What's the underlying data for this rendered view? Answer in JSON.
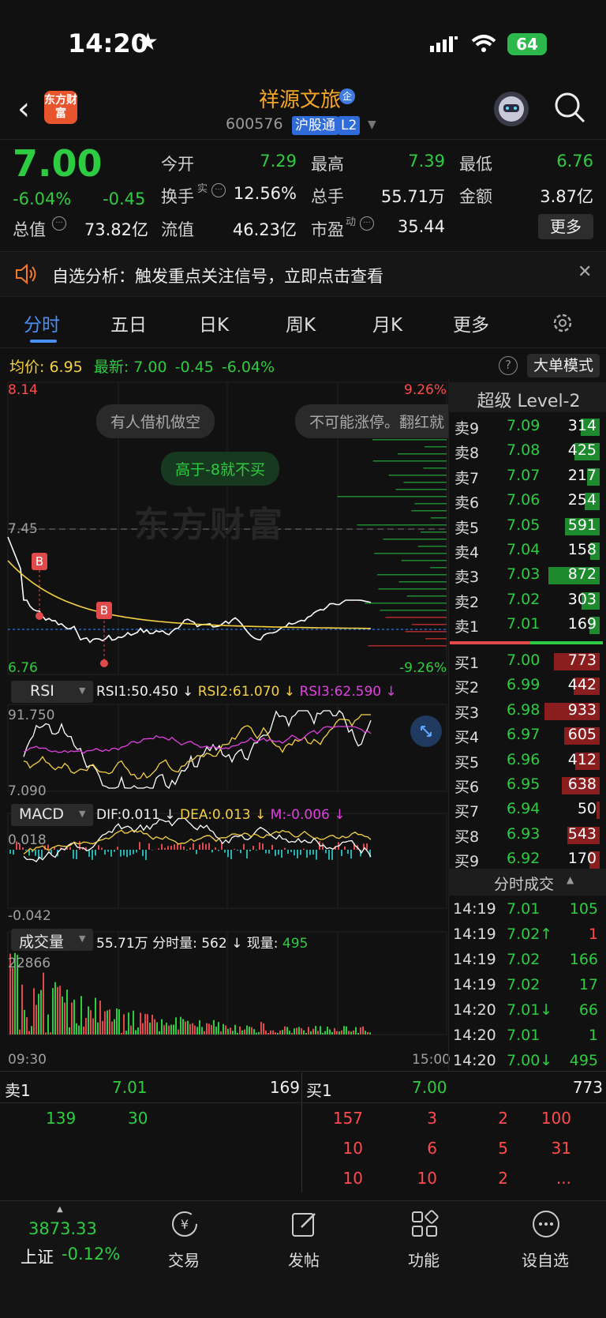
{
  "status_bar": {
    "time": "14:20",
    "battery": "64"
  },
  "header": {
    "logo_text": "东方财富",
    "stock_name": "祥源文旅",
    "stock_code": "600576",
    "tags": [
      "沪股通",
      "L2"
    ]
  },
  "quote": {
    "price": "7.00",
    "change_pct": "-6.04%",
    "change": "-0.45",
    "open_label": "今开",
    "open": "7.29",
    "high_label": "最高",
    "high": "7.39",
    "low_label": "最低",
    "low": "6.76",
    "turnover_label": "换手",
    "turnover_sup": "实",
    "turnover": "12.56%",
    "volume_label": "总手",
    "volume": "55.71万",
    "amount_label": "金额",
    "amount": "3.87亿",
    "mktcap_label": "总值",
    "mktcap": "73.82亿",
    "float_label": "流值",
    "float": "46.23亿",
    "pe_label": "市盈",
    "pe_sup": "动",
    "pe": "35.44",
    "more_label": "更多"
  },
  "notice": {
    "text": "自选分析：触发重点关注信号，立即点击查看"
  },
  "tabs": [
    "分时",
    "五日",
    "日K",
    "周K",
    "月K",
    "更多"
  ],
  "chart_header": {
    "avg_label": "均价:",
    "avg": "6.95",
    "latest_label": "最新:",
    "latest": "7.00",
    "change": "-0.45",
    "change_pct": "-6.04%",
    "mode_button": "大单模式"
  },
  "chart_labels": {
    "ymax": "8.14",
    "ymax_pct": "9.26%",
    "ymin": "6.76",
    "ymin_pct": "-9.26%",
    "ref_line": "7.45",
    "bubble1": "有人借机做空",
    "bubble2": "不可能涨停。翻红就",
    "bubble3": "高于-8就不买",
    "watermark": "东方财富",
    "buy_marker": "B",
    "time_start": "09:30",
    "time_end": "15:00"
  },
  "rsi": {
    "name": "RSI",
    "rsi1": "RSI1:50.450",
    "rsi2": "RSI2:61.070",
    "rsi3": "RSI3:62.590",
    "top": "91.750",
    "bottom": "7.090"
  },
  "macd": {
    "name": "MACD",
    "dif": "DIF:0.011",
    "dea": "DEA:0.013",
    "m": "M:-0.006",
    "top": "0.018",
    "bottom": "-0.042"
  },
  "volume_panel": {
    "name": "成交量",
    "total": "55.71万",
    "minute_label": "分时量:",
    "minute": "562",
    "current_label": "现量:",
    "current": "495",
    "top": "22866"
  },
  "level2": {
    "title": "超级 Level-2",
    "sells": [
      {
        "label": "卖9",
        "price": "7.09",
        "vol": "314"
      },
      {
        "label": "卖8",
        "price": "7.08",
        "vol": "425"
      },
      {
        "label": "卖7",
        "price": "7.07",
        "vol": "217"
      },
      {
        "label": "卖6",
        "price": "7.06",
        "vol": "254"
      },
      {
        "label": "卖5",
        "price": "7.05",
        "vol": "591"
      },
      {
        "label": "卖4",
        "price": "7.04",
        "vol": "158"
      },
      {
        "label": "卖3",
        "price": "7.03",
        "vol": "872"
      },
      {
        "label": "卖2",
        "price": "7.02",
        "vol": "303"
      },
      {
        "label": "卖1",
        "price": "7.01",
        "vol": "169"
      }
    ],
    "buys": [
      {
        "label": "买1",
        "price": "7.00",
        "vol": "773"
      },
      {
        "label": "买2",
        "price": "6.99",
        "vol": "442"
      },
      {
        "label": "买3",
        "price": "6.98",
        "vol": "933"
      },
      {
        "label": "买4",
        "price": "6.97",
        "vol": "605"
      },
      {
        "label": "买5",
        "price": "6.96",
        "vol": "412"
      },
      {
        "label": "买6",
        "price": "6.95",
        "vol": "638"
      },
      {
        "label": "买7",
        "price": "6.94",
        "vol": "50"
      },
      {
        "label": "买8",
        "price": "6.93",
        "vol": "543"
      },
      {
        "label": "买9",
        "price": "6.92",
        "vol": "170"
      }
    ],
    "trades_title": "分时成交",
    "trades": [
      {
        "time": "14:19",
        "price": "7.01",
        "vol": "105"
      },
      {
        "time": "14:19",
        "price": "7.02↑",
        "vol": "1"
      },
      {
        "time": "14:19",
        "price": "7.02",
        "vol": "166"
      },
      {
        "time": "14:19",
        "price": "7.02",
        "vol": "17"
      },
      {
        "time": "14:20",
        "price": "7.01↓",
        "vol": "66"
      },
      {
        "time": "14:20",
        "price": "7.01",
        "vol": "1"
      },
      {
        "time": "14:20",
        "price": "7.00↓",
        "vol": "495"
      }
    ]
  },
  "queue": {
    "sell_label": "卖1",
    "sell_price": "7.01",
    "sell_vol": "169",
    "buy_label": "买1",
    "buy_price": "7.00",
    "buy_vol": "773",
    "sell_orders": [
      "139",
      "30"
    ],
    "buy_orders": [
      [
        "157",
        "3",
        "2",
        "100"
      ],
      [
        "10",
        "6",
        "5",
        "31"
      ],
      [
        "10",
        "10",
        "2",
        "..."
      ]
    ]
  },
  "bottom_nav": {
    "index_value": "3873.33",
    "index_name": "上证",
    "index_change": "-0.12%",
    "items": [
      "交易",
      "发帖",
      "功能",
      "设自选"
    ]
  }
}
